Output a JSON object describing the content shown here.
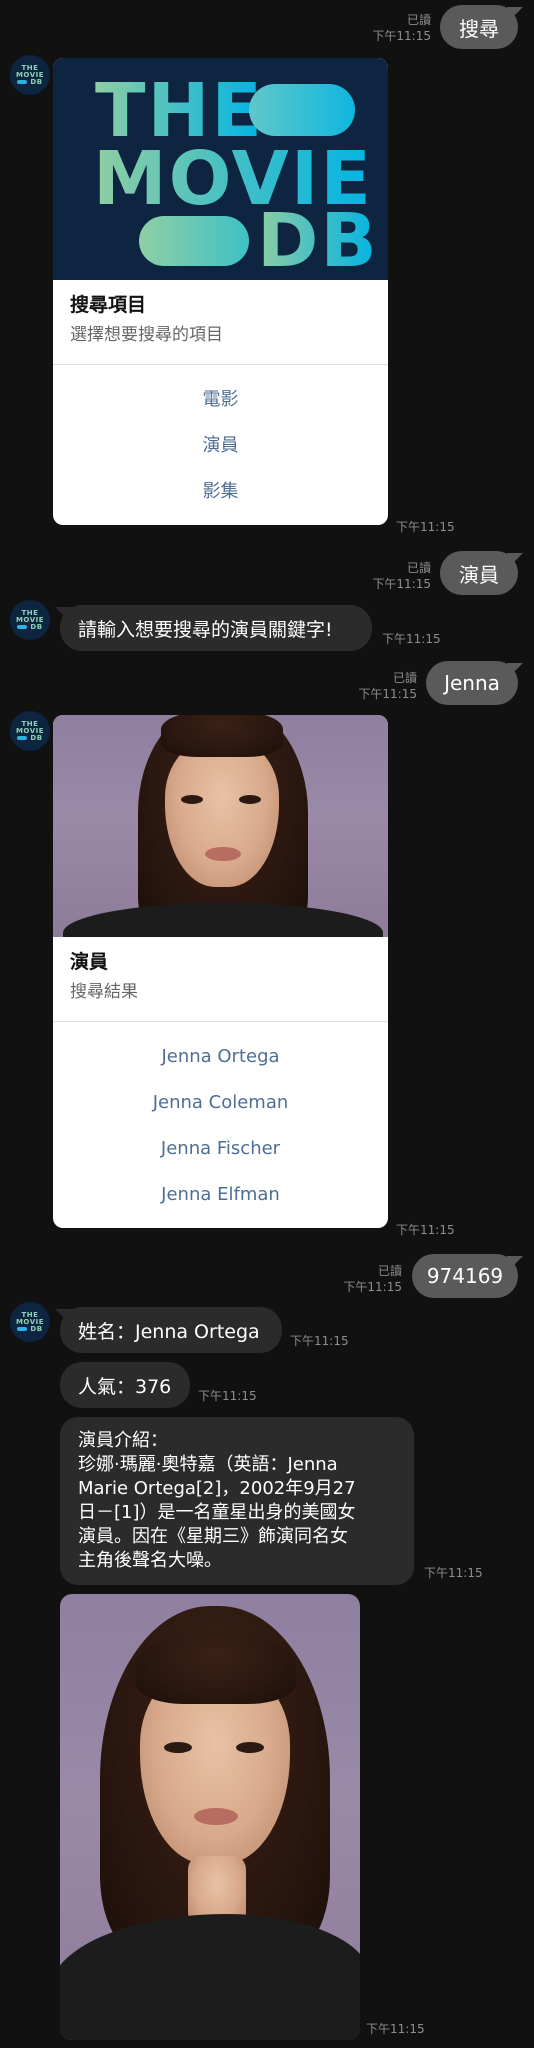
{
  "colors": {
    "background": "#111111",
    "outgoing_bubble": "#5a5a5a",
    "incoming_bubble": "#2b2b2b",
    "link": "#4e6e96"
  },
  "bot": {
    "avatar_icon": "tmdb-logo",
    "avatar_lines": [
      "THE",
      "MOVIE",
      "DB"
    ]
  },
  "messages": {
    "m1": {
      "text": "搜尋",
      "read": "已讀",
      "time": "下午11:15"
    },
    "card1": {
      "logo_lines": [
        "THE",
        "MOVIE",
        "DB"
      ],
      "title": "搜尋項目",
      "subtitle": "選擇想要搜尋的項目",
      "actions": [
        "電影",
        "演員",
        "影集"
      ],
      "time": "下午11:15"
    },
    "m2": {
      "text": "演員",
      "read": "已讀",
      "time": "下午11:15"
    },
    "bot2": {
      "text": "請輸入想要搜尋的演員關鍵字!",
      "time": "下午11:15"
    },
    "m3": {
      "text": "Jenna",
      "read": "已讀",
      "time": "下午11:15"
    },
    "card2": {
      "title": "演員",
      "subtitle": "搜尋結果",
      "actions": [
        "Jenna Ortega",
        "Jenna Coleman",
        "Jenna Fischer",
        "Jenna Elfman"
      ],
      "time": "下午11:15"
    },
    "m4": {
      "text": "974169",
      "read": "已讀",
      "time": "下午11:15"
    },
    "name": {
      "text": "姓名：Jenna Ortega",
      "time": "下午11:15"
    },
    "popularity": {
      "text": "人氣：376",
      "time": "下午11:15"
    },
    "bio": {
      "lines": [
        "演員介紹：",
        "珍娜·瑪麗·奧特嘉（英語：Jenna",
        "Marie Ortega[2]，2002年9月27",
        "日－[1]）是一名童星出身的美國女",
        "演員。因在《星期三》飾演同名女",
        "主角後聲名大噪。"
      ],
      "time": "下午11:15"
    },
    "photo": {
      "time": "下午11:15"
    }
  }
}
